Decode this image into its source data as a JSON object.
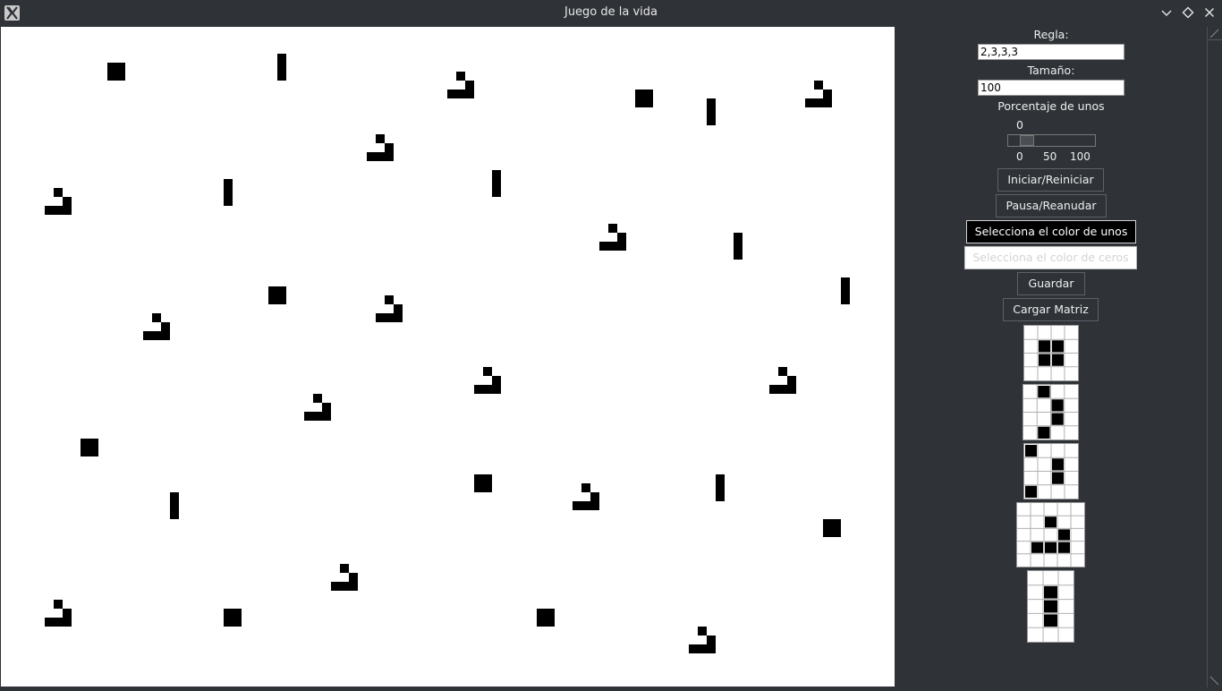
{
  "window": {
    "title": "Juego de la vida"
  },
  "controls": {
    "rule_label": "Regla:",
    "rule_value": "2,3,3,3",
    "size_label": "Tamaño:",
    "size_value": "100",
    "percent_label": "Porcentaje de unos",
    "percent_value": "0",
    "slider_value": 0,
    "slider_ticks": [
      "0",
      "50",
      "100"
    ],
    "start_label": "Iniciar/Reiniciar",
    "pause_label": "Pausa/Reanudar",
    "ones_color_label": "Selecciona el color de unos",
    "zeros_color_label": "Selecciona el color de ceros",
    "save_label": "Guardar",
    "load_label": "Cargar Matriz"
  },
  "colors": {
    "ones": "#000000",
    "zeros": "#ffffff",
    "background": "#2f3338"
  },
  "board_grid": {
    "cols": 100,
    "rows": 74
  },
  "board_patterns": [
    {
      "type": "block",
      "col": 12,
      "row": 4
    },
    {
      "type": "blinker",
      "col": 31,
      "row": 3
    },
    {
      "type": "glider",
      "col": 50,
      "row": 5
    },
    {
      "type": "block",
      "col": 71,
      "row": 7
    },
    {
      "type": "blinker",
      "col": 79,
      "row": 8
    },
    {
      "type": "glider",
      "col": 90,
      "row": 6
    },
    {
      "type": "glider",
      "col": 41,
      "row": 12
    },
    {
      "type": "blinker",
      "col": 25,
      "row": 17
    },
    {
      "type": "blinker",
      "col": 55,
      "row": 16
    },
    {
      "type": "glider",
      "col": 5,
      "row": 18
    },
    {
      "type": "glider",
      "col": 67,
      "row": 22
    },
    {
      "type": "blinker",
      "col": 82,
      "row": 23
    },
    {
      "type": "block",
      "col": 30,
      "row": 29
    },
    {
      "type": "glider",
      "col": 42,
      "row": 30
    },
    {
      "type": "blinker",
      "col": 94,
      "row": 28
    },
    {
      "type": "glider",
      "col": 16,
      "row": 32
    },
    {
      "type": "glider",
      "col": 53,
      "row": 38
    },
    {
      "type": "glider",
      "col": 86,
      "row": 38
    },
    {
      "type": "glider",
      "col": 34,
      "row": 41
    },
    {
      "type": "block",
      "col": 9,
      "row": 46
    },
    {
      "type": "block",
      "col": 53,
      "row": 50
    },
    {
      "type": "glider",
      "col": 64,
      "row": 51
    },
    {
      "type": "blinker",
      "col": 80,
      "row": 50
    },
    {
      "type": "blinker",
      "col": 19,
      "row": 52
    },
    {
      "type": "block",
      "col": 92,
      "row": 55
    },
    {
      "type": "glider",
      "col": 37,
      "row": 60
    },
    {
      "type": "glider",
      "col": 5,
      "row": 64
    },
    {
      "type": "block",
      "col": 25,
      "row": 65
    },
    {
      "type": "block",
      "col": 60,
      "row": 65
    },
    {
      "type": "glider",
      "col": 77,
      "row": 67
    }
  ],
  "pattern_previews": [
    {
      "name": "block",
      "cols": 4,
      "rows": 4,
      "cells": [
        [
          1,
          1
        ],
        [
          2,
          1
        ],
        [
          1,
          2
        ],
        [
          2,
          2
        ]
      ]
    },
    {
      "name": "glider-vertical",
      "cols": 4,
      "rows": 4,
      "cells": [
        [
          1,
          0
        ],
        [
          2,
          1
        ],
        [
          2,
          2
        ],
        [
          1,
          3
        ]
      ]
    },
    {
      "name": "pattern-3",
      "cols": 4,
      "rows": 4,
      "cells": [
        [
          0,
          0
        ],
        [
          2,
          1
        ],
        [
          2,
          2
        ],
        [
          0,
          3
        ]
      ]
    },
    {
      "name": "glider",
      "cols": 5,
      "rows": 5,
      "cells": [
        [
          2,
          1
        ],
        [
          3,
          2
        ],
        [
          1,
          3
        ],
        [
          2,
          3
        ],
        [
          3,
          3
        ]
      ]
    },
    {
      "name": "blinker",
      "cols": 3,
      "rows": 5,
      "cells": [
        [
          1,
          1
        ],
        [
          1,
          2
        ],
        [
          1,
          3
        ]
      ]
    }
  ]
}
